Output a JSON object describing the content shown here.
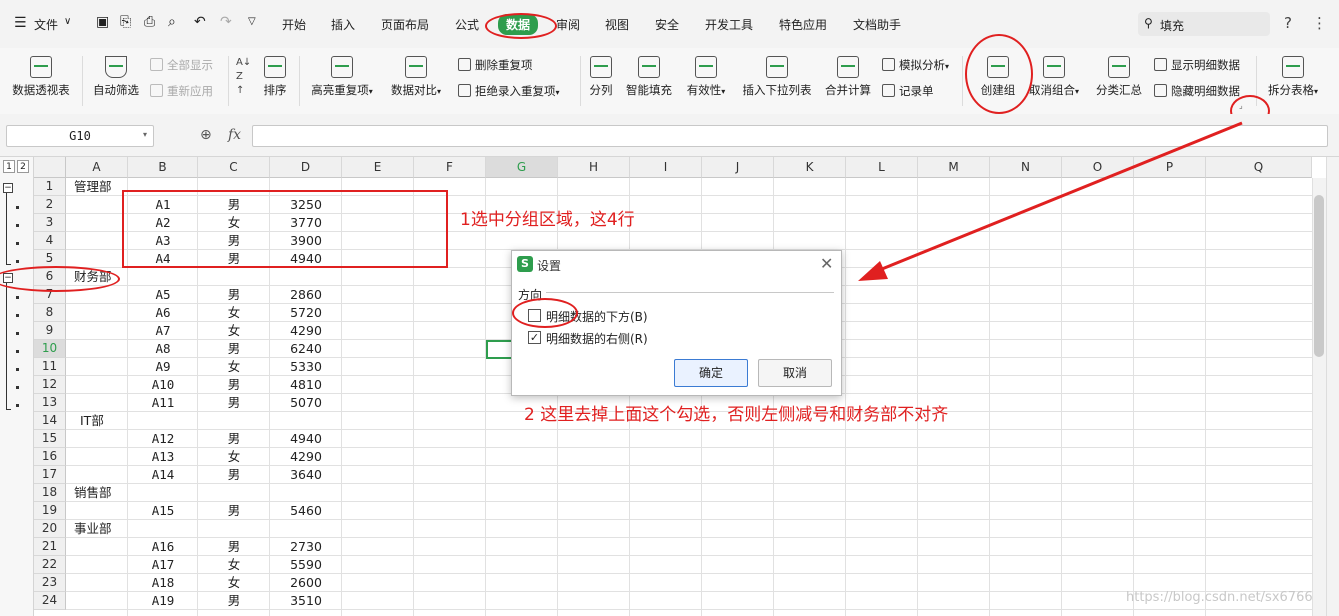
{
  "menubar": {
    "file_label": "文件",
    "tabs": [
      "开始",
      "插入",
      "页面布局",
      "公式",
      "数据",
      "审阅",
      "视图",
      "安全",
      "开发工具",
      "特色应用",
      "文档助手"
    ],
    "search_placeholder": "填充",
    "help": "?",
    "more": "⋮"
  },
  "ribbon": {
    "pivot": "数据透视表",
    "autofilter": "自动筛选",
    "show_all": "全部显示",
    "reapply": "重新应用",
    "sort": "排序",
    "highlight_dup": "高亮重复项",
    "compare": "数据对比",
    "remove_dup": "删除重复项",
    "reject_dup": "拒绝录入重复项",
    "split_col": "分列",
    "smart_fill": "智能填充",
    "validity": "有效性",
    "insert_dropdown": "插入下拉列表",
    "consolidate": "合并计算",
    "what_if": "模拟分析",
    "record": "记录单",
    "create_group": "创建组",
    "ungroup": "取消组合",
    "subtotal": "分类汇总",
    "show_detail": "显示明细数据",
    "hide_detail": "隐藏明细数据",
    "split_table": "拆分表格"
  },
  "formula": {
    "cell_ref": "G10",
    "fx": "fx",
    "value": ""
  },
  "grid": {
    "columns": [
      "A",
      "B",
      "C",
      "D",
      "E",
      "F",
      "G",
      "H",
      "I",
      "J",
      "K",
      "L",
      "M",
      "N",
      "O",
      "P",
      "Q"
    ],
    "row_numbers": [
      "1",
      "2",
      "3",
      "4",
      "5",
      "6",
      "7",
      "8",
      "9",
      "10",
      "11",
      "12",
      "13",
      "14",
      "15",
      "16",
      "17",
      "18",
      "19",
      "20",
      "21",
      "22",
      "23",
      "24"
    ],
    "rows": [
      {
        "a": "管理部",
        "b": "",
        "c": "",
        "d": ""
      },
      {
        "a": "",
        "b": "A1",
        "c": "男",
        "d": "3250"
      },
      {
        "a": "",
        "b": "A2",
        "c": "女",
        "d": "3770"
      },
      {
        "a": "",
        "b": "A3",
        "c": "男",
        "d": "3900"
      },
      {
        "a": "",
        "b": "A4",
        "c": "男",
        "d": "4940"
      },
      {
        "a": "财务部",
        "b": "",
        "c": "",
        "d": ""
      },
      {
        "a": "",
        "b": "A5",
        "c": "男",
        "d": "2860"
      },
      {
        "a": "",
        "b": "A6",
        "c": "女",
        "d": "5720"
      },
      {
        "a": "",
        "b": "A7",
        "c": "女",
        "d": "4290"
      },
      {
        "a": "",
        "b": "A8",
        "c": "男",
        "d": "6240"
      },
      {
        "a": "",
        "b": "A9",
        "c": "女",
        "d": "5330"
      },
      {
        "a": "",
        "b": "A10",
        "c": "男",
        "d": "4810"
      },
      {
        "a": "",
        "b": "A11",
        "c": "男",
        "d": "5070"
      },
      {
        "a": "IT部",
        "b": "",
        "c": "",
        "d": ""
      },
      {
        "a": "",
        "b": "A12",
        "c": "男",
        "d": "4940"
      },
      {
        "a": "",
        "b": "A13",
        "c": "女",
        "d": "4290"
      },
      {
        "a": "",
        "b": "A14",
        "c": "男",
        "d": "3640"
      },
      {
        "a": "销售部",
        "b": "",
        "c": "",
        "d": ""
      },
      {
        "a": "",
        "b": "A15",
        "c": "男",
        "d": "5460"
      },
      {
        "a": "事业部",
        "b": "",
        "c": "",
        "d": ""
      },
      {
        "a": "",
        "b": "A16",
        "c": "男",
        "d": "2730"
      },
      {
        "a": "",
        "b": "A17",
        "c": "女",
        "d": "5590"
      },
      {
        "a": "",
        "b": "A18",
        "c": "女",
        "d": "2600"
      },
      {
        "a": "",
        "b": "A19",
        "c": "男",
        "d": "3510"
      }
    ],
    "outline_levels": [
      "1",
      "2"
    ]
  },
  "dialog": {
    "title": "设置",
    "section": "方向",
    "option_below": "明细数据的下方(B)",
    "option_below_checked": false,
    "option_right": "明细数据的右侧(R)",
    "option_right_checked": true,
    "ok": "确定",
    "cancel": "取消"
  },
  "annotations": {
    "step1": "1选中分组区域，这4行",
    "step2": "2 这里去掉上面这个勾选，否则左侧减号和财务部不对齐",
    "color": "#e02020"
  },
  "watermark": "https://blog.csdn.net/sx6766"
}
